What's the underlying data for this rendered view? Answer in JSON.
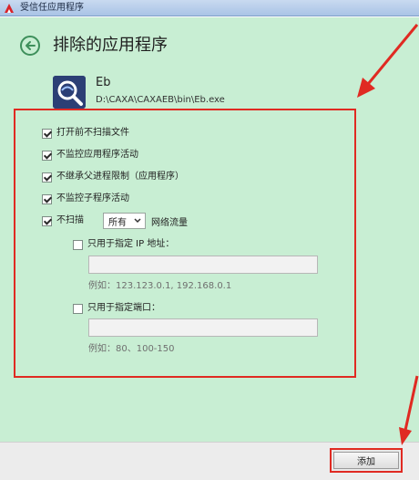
{
  "window": {
    "title": "受信任应用程序"
  },
  "page": {
    "title": "排除的应用程序"
  },
  "app": {
    "name": "Eb",
    "path": "D:\\CAXA\\CAXAEB\\bin\\Eb.exe"
  },
  "options": [
    {
      "label": "打开前不扫描文件",
      "checked": true
    },
    {
      "label": "不监控应用程序活动",
      "checked": true
    },
    {
      "label": "不继承父进程限制（应用程序）",
      "checked": true
    },
    {
      "label": "不监控子程序活动",
      "checked": true
    },
    {
      "label": "不扫描",
      "checked": true
    }
  ],
  "traffic": {
    "selected": "所有",
    "suffix": "网络流量"
  },
  "ip_filter": {
    "label": "只用于指定 IP 地址：",
    "checked": false,
    "value": "",
    "hint": "例如：123.123.0.1, 192.168.0.1"
  },
  "port_filter": {
    "label": "只用于指定端口：",
    "checked": false,
    "value": "",
    "hint": "例如：80、100-150"
  },
  "footer": {
    "add_label": "添加"
  },
  "colors": {
    "accent_green": "#3e8f5b",
    "panel_bg": "#c8eed3",
    "annotation_red": "#e02a22"
  }
}
